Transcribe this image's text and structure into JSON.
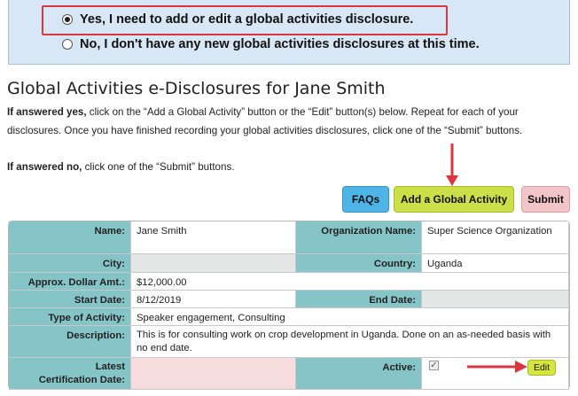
{
  "question": {
    "option_yes": "Yes, I need to add or edit a global activities disclosure.",
    "option_no": "No, I don't have any new global activities disclosures at this time.",
    "selected": "yes"
  },
  "page_title": "Global Activities e-Disclosures for Jane Smith",
  "instructions": {
    "yes_prefix": "If answered yes,",
    "yes_text": " click on the “Add a Global Activity” button or the “Edit” button(s) below. Repeat for each of your disclosures. Once you have finished recording your global activities disclosures, click one of the “Submit” buttons.",
    "no_prefix": "If answered no,",
    "no_text": " click one of the “Submit” buttons."
  },
  "buttons": {
    "faqs": "FAQs",
    "add": "Add a Global Activity",
    "submit": "Submit",
    "edit": "Edit"
  },
  "record": {
    "name_label": "Name:",
    "name": "Jane Smith",
    "org_label": "Organization Name:",
    "org": "Super Science Organization",
    "city_label": "City:",
    "city": "",
    "country_label": "Country:",
    "country": "Uganda",
    "amount_label": "Approx. Dollar Amt.:",
    "amount": "$12,000.00",
    "start_label": "Start Date:",
    "start": "8/12/2019",
    "end_label": "End Date:",
    "end": "",
    "type_label": "Type of Activity:",
    "type": "Speaker engagement, Consulting",
    "desc_label": "Description:",
    "desc": "This is for consulting work on crop development in Uganda. Done on an as-needed basis with no end date.",
    "cert_label": "Latest Certification Date:",
    "cert": "",
    "active_label": "Active:",
    "active_checked": true
  },
  "colors": {
    "label_bg": "#85c4c7",
    "highlight": "#d9363e",
    "faqs": "#4eb5e6",
    "add": "#cbe048",
    "submit": "#f2c5c8"
  }
}
